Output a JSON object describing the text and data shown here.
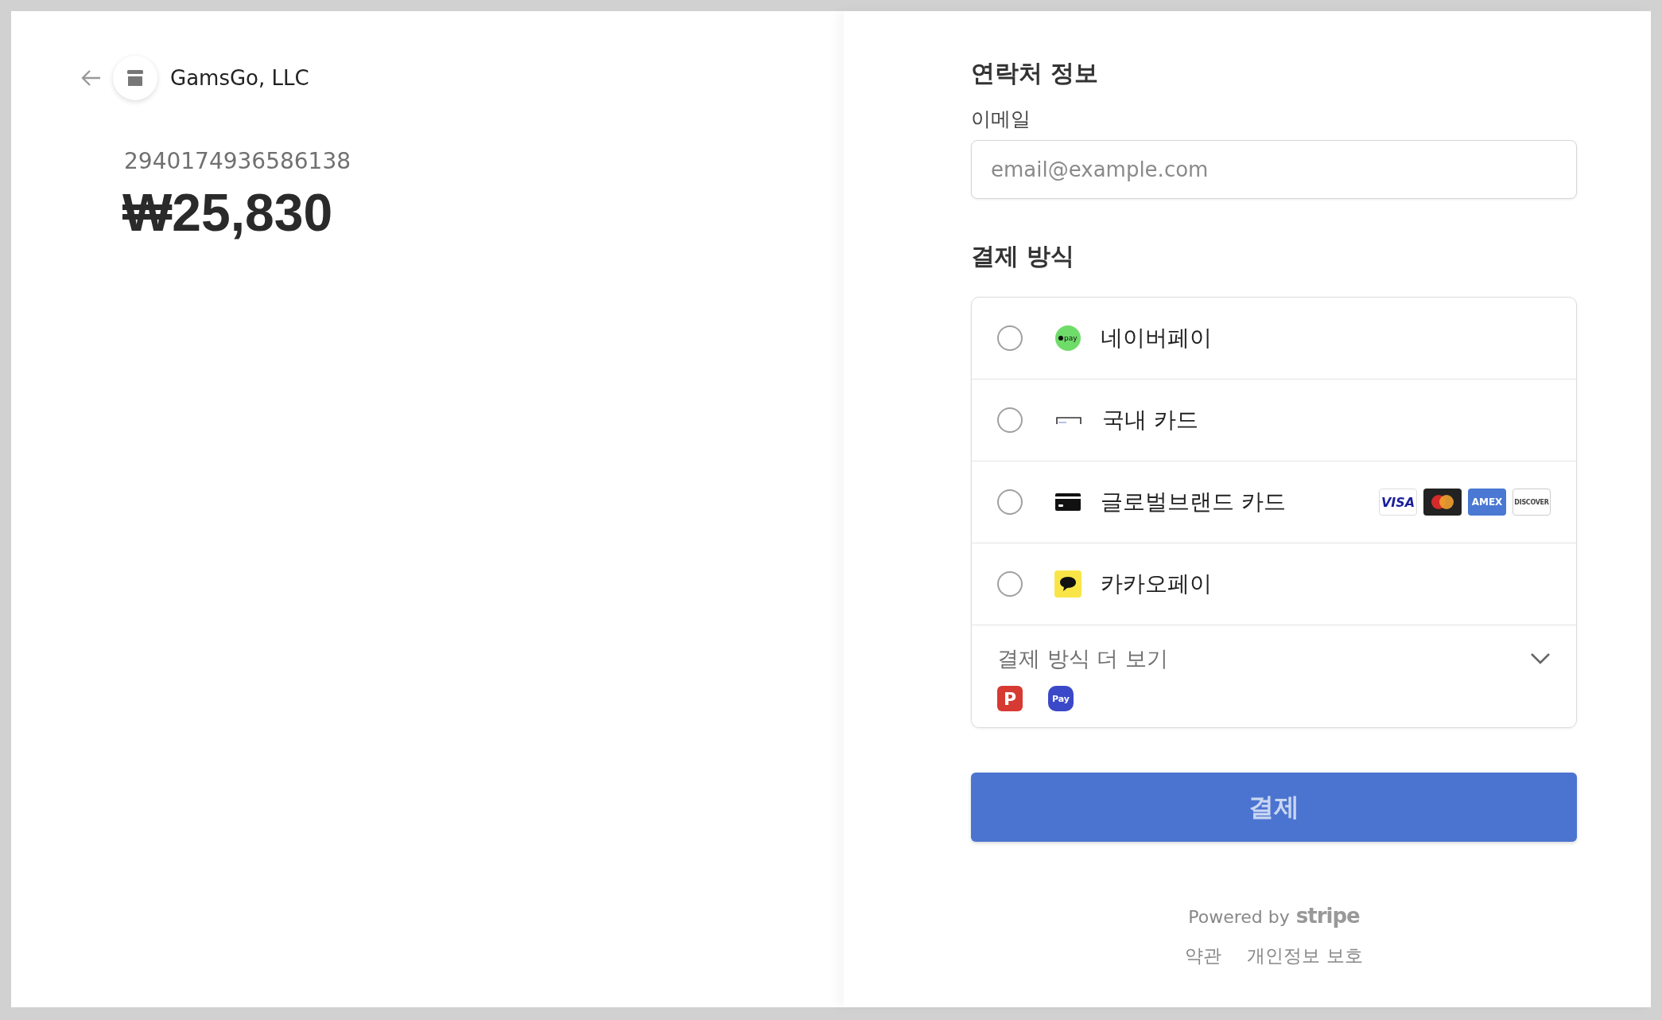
{
  "merchant": {
    "name": "GamsGo, LLC"
  },
  "order": {
    "number": "2940174936586138",
    "amount": "₩25,830"
  },
  "contact": {
    "title": "연락처 정보",
    "email_label": "이메일",
    "email_placeholder": "email@example.com"
  },
  "payment": {
    "title": "결제 방식",
    "methods": [
      {
        "label": "네이버페이",
        "kind": "naverpay",
        "icon_text": "pay",
        "selected": false
      },
      {
        "label": "국내 카드",
        "kind": "localcard",
        "selected": false
      },
      {
        "label": "글로벌브랜드 카드",
        "kind": "card",
        "selected": false,
        "brands": [
          {
            "kind": "visa",
            "text": "VISA"
          },
          {
            "kind": "mastercard"
          },
          {
            "kind": "amex",
            "text": "AMEX"
          },
          {
            "kind": "discover",
            "text": "DISCOVER"
          }
        ]
      },
      {
        "label": "카카오페이",
        "kind": "kakao",
        "selected": false
      }
    ],
    "more": {
      "label": "결제 방식 더 보기",
      "expanded": false,
      "icons": [
        {
          "kind": "payco",
          "text": "P"
        },
        {
          "kind": "samsungpay",
          "text": "Pay"
        }
      ]
    }
  },
  "pay_button": {
    "label": "결제"
  },
  "footer": {
    "powered": "Powered by",
    "brand": "stripe",
    "links": [
      "약관",
      "개인정보 보호"
    ]
  }
}
